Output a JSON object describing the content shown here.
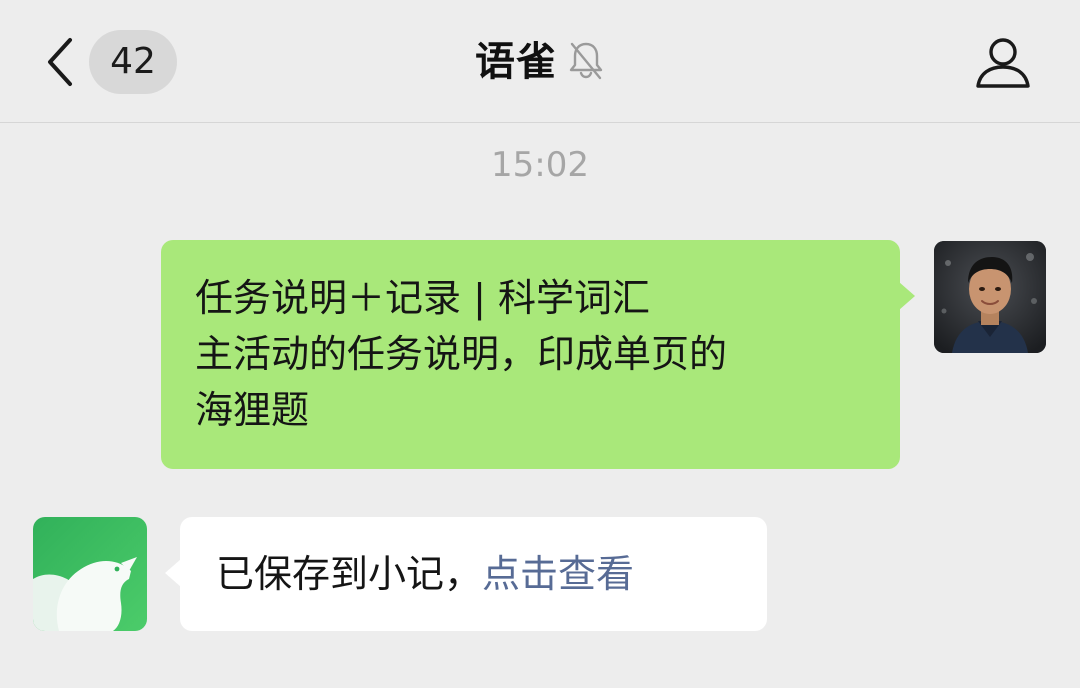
{
  "header": {
    "unread_count": "42",
    "title": "语雀",
    "muted": true,
    "icons": {
      "back": "chevron-left-icon",
      "mute": "bell-slash-icon",
      "profile": "person-icon"
    }
  },
  "messages": [
    {
      "type": "time",
      "text": "15:02"
    },
    {
      "direction": "outgoing",
      "text": "任务说明＋记录 | 科学词汇\n主活动的任务说明，印成单页的\n海狸题",
      "bubble_color": "#a9e87a"
    },
    {
      "direction": "incoming",
      "sender": "语雀",
      "text": "已保存到小记，",
      "link_text": "点击查看",
      "link_color": "#576b95"
    }
  ],
  "colors": {
    "background": "#ededed",
    "bot_avatar": "#3fc15f"
  }
}
